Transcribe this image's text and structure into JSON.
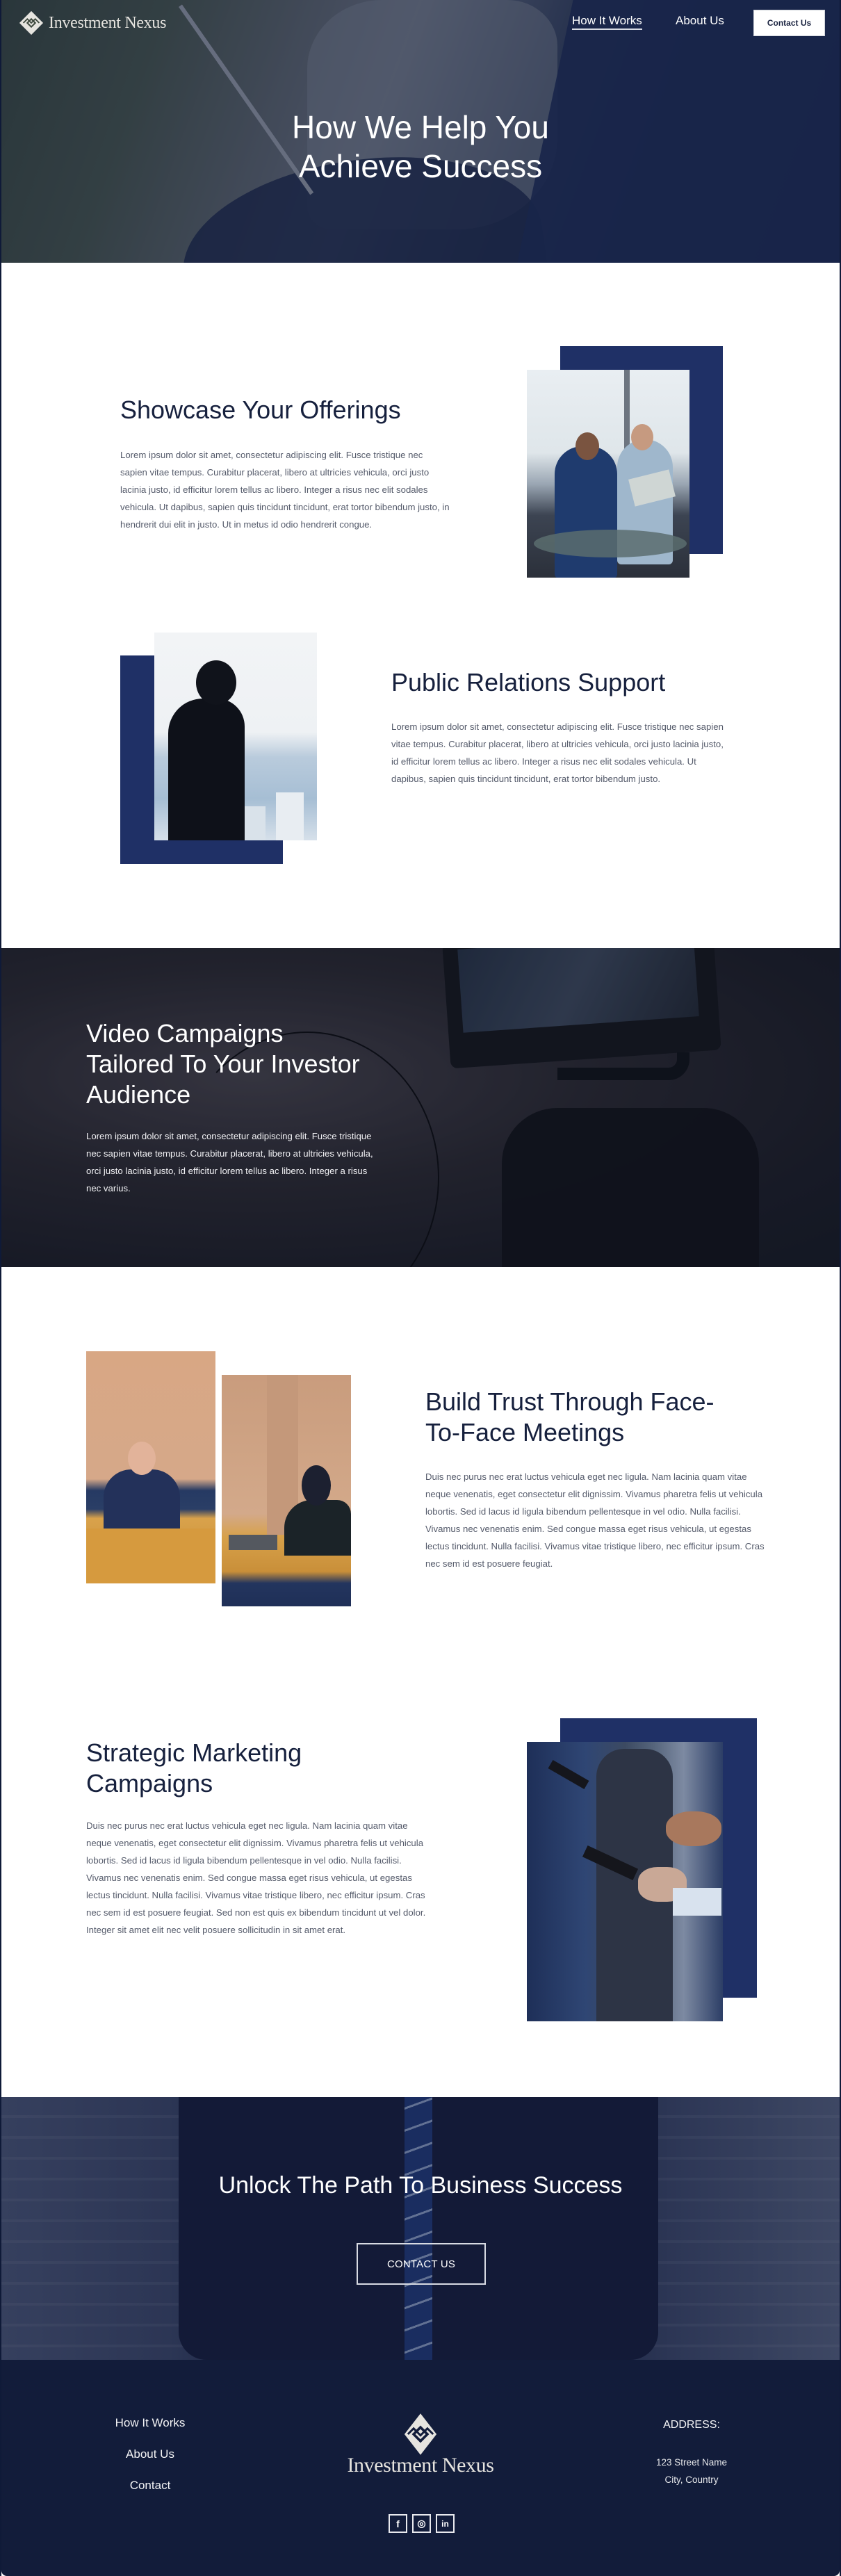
{
  "brand": {
    "name": "Investment Nexus",
    "logo_icon": "diamond-logo-icon",
    "primary_color": "#1f3066",
    "footer_color": "#121c3a",
    "logo_color": "#e6e4df"
  },
  "nav": {
    "items": [
      {
        "label": "How It Works",
        "active": true
      },
      {
        "label": "About Us",
        "active": false
      }
    ],
    "cta_label": "Contact Us"
  },
  "hero": {
    "title_line1": "How We Help You",
    "title_line2": "Achieve Success"
  },
  "sections": [
    {
      "title": "Showcase Your Offerings",
      "body": "Lorem ipsum dolor sit amet, consectetur adipiscing elit. Fusce tristique nec sapien vitae tempus. Curabitur placerat, libero at ultricies vehicula, orci justo lacinia justo, id efficitur lorem tellus ac libero. Integer a risus nec elit sodales vehicula. Ut dapibus, sapien quis tincidunt tincidunt, erat tortor bibendum justo, in hendrerit dui elit in justo. Ut in metus id odio hendrerit congue.",
      "image": "two businessmen on sofa looking at laptop"
    },
    {
      "title": "Public Relations Support",
      "body": "Lorem ipsum dolor sit amet, consectetur adipiscing elit. Fusce tristique nec sapien vitae tempus. Curabitur placerat, libero at ultricies vehicula, orci justo lacinia justo, id efficitur lorem tellus ac libero. Integer a risus nec elit sodales vehicula. Ut dapibus, sapien quis tincidunt tincidunt, erat tortor bibendum justo.",
      "image": "silhouette of man looking at city skyline"
    },
    {
      "title_line1": "Video Campaigns",
      "title_line2": "Tailored To Your Investor",
      "title_line3": "Audience",
      "body": "Lorem ipsum dolor sit amet, consectetur adipiscing elit. Fusce tristique nec sapien vitae tempus. Curabitur placerat, libero at ultricies vehicula, orci justo lacinia justo, id efficitur lorem tellus ac libero. Integer a risus nec varius.",
      "image": "camera with monitor filming"
    },
    {
      "title_line1": "Build Trust Through Face-",
      "title_line2": "To-Face Meetings",
      "body": "Duis nec purus nec erat luctus vehicula eget nec ligula. Nam lacinia quam vitae neque venenatis, eget consectetur elit dignissim. Vivamus pharetra felis ut vehicula lobortis. Sed id lacus id ligula bibendum pellentesque in vel odio. Nulla facilisi. Vivamus nec venenatis enim. Sed congue massa eget risus vehicula, ut egestas lectus tincidunt. Nulla facilisi. Vivamus vitae tristique libero, nec efficitur ipsum. Cras nec sem id est posuere feugiat.",
      "images": [
        "businessman at meeting table",
        "businesswoman with laptop at meeting table"
      ]
    },
    {
      "title_line1": "Strategic Marketing",
      "title_line2": "Campaigns",
      "body": "Duis nec purus nec erat luctus vehicula eget nec ligula. Nam lacinia quam vitae neque venenatis, eget consectetur elit dignissim. Vivamus pharetra felis ut vehicula lobortis. Sed id lacus id ligula bibendum pellentesque in vel odio. Nulla facilisi. Vivamus nec venenatis enim. Sed congue massa eget risus vehicula, ut egestas lectus tincidunt. Nulla facilisi. Vivamus vitae tristique libero, nec efficitur ipsum. Cras nec sem id est posuere feugiat. Sed non est quis ex bibendum tincidunt ut vel dolor. Integer sit amet elit nec velit posuere sollicitudin in sit amet erat.",
      "image": "people in suits using phones"
    }
  ],
  "cta": {
    "title": "Unlock The Path To Business Success",
    "button_label": "CONTACT US"
  },
  "footer": {
    "links": [
      "How It Works",
      "About Us",
      "Contact"
    ],
    "brand": "Investment Nexus",
    "address_title": "ADDRESS:",
    "address_line1": "123 Street Name",
    "address_line2": "City, Country",
    "social": [
      {
        "name": "facebook",
        "glyph": "f"
      },
      {
        "name": "instagram",
        "glyph": "◎"
      },
      {
        "name": "linkedin",
        "glyph": "in"
      }
    ]
  }
}
